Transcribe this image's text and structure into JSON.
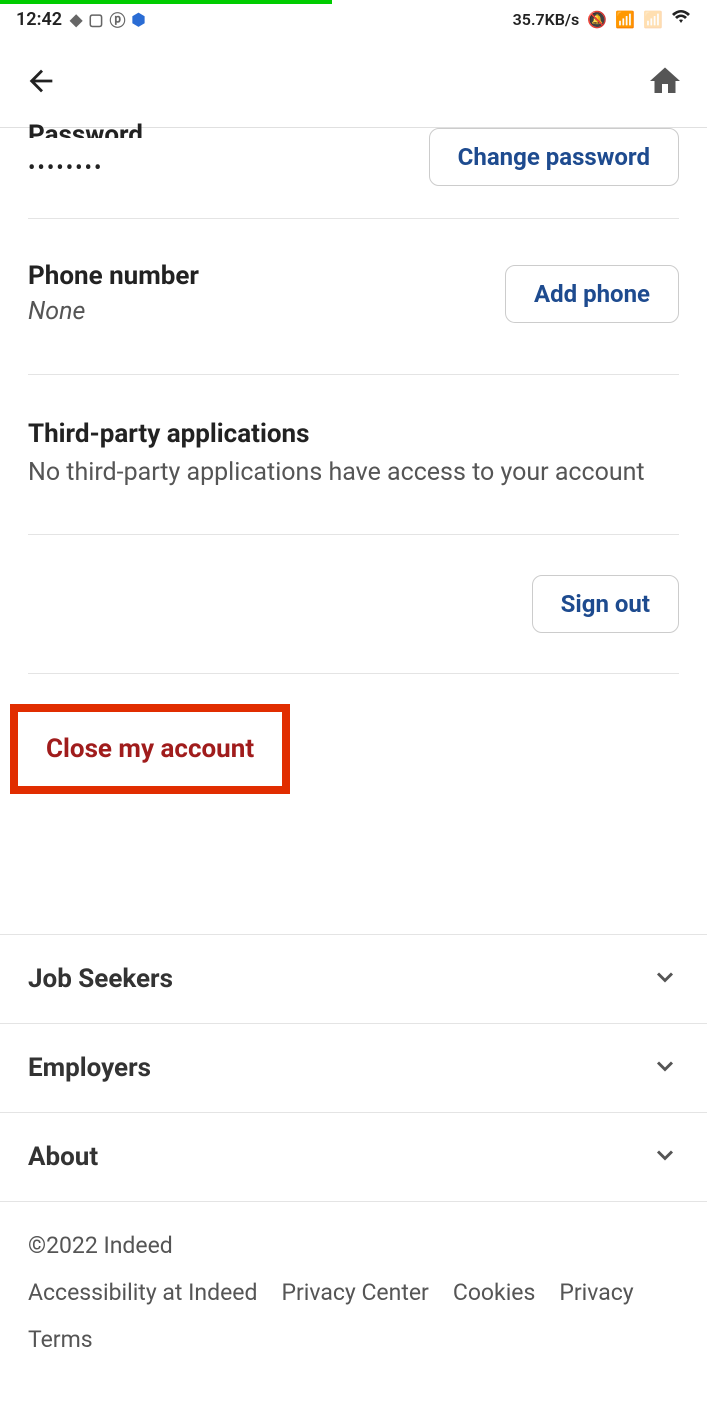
{
  "statusbar": {
    "time": "12:42",
    "net_speed": "35.7KB/s"
  },
  "sections": {
    "password": {
      "label": "Password",
      "masked": "••••••••",
      "action": "Change password"
    },
    "phone": {
      "label": "Phone number",
      "value": "None",
      "action": "Add phone"
    },
    "third_party": {
      "title": "Third-party applications",
      "desc": "No third-party applications have access to your account"
    },
    "signout": "Sign out",
    "close_account": "Close my account"
  },
  "footer": {
    "rows": [
      "Job Seekers",
      "Employers",
      "About"
    ],
    "copyright": "©2022 Indeed",
    "links": [
      "Accessibility at Indeed",
      "Privacy Center",
      "Cookies",
      "Privacy",
      "Terms"
    ]
  }
}
